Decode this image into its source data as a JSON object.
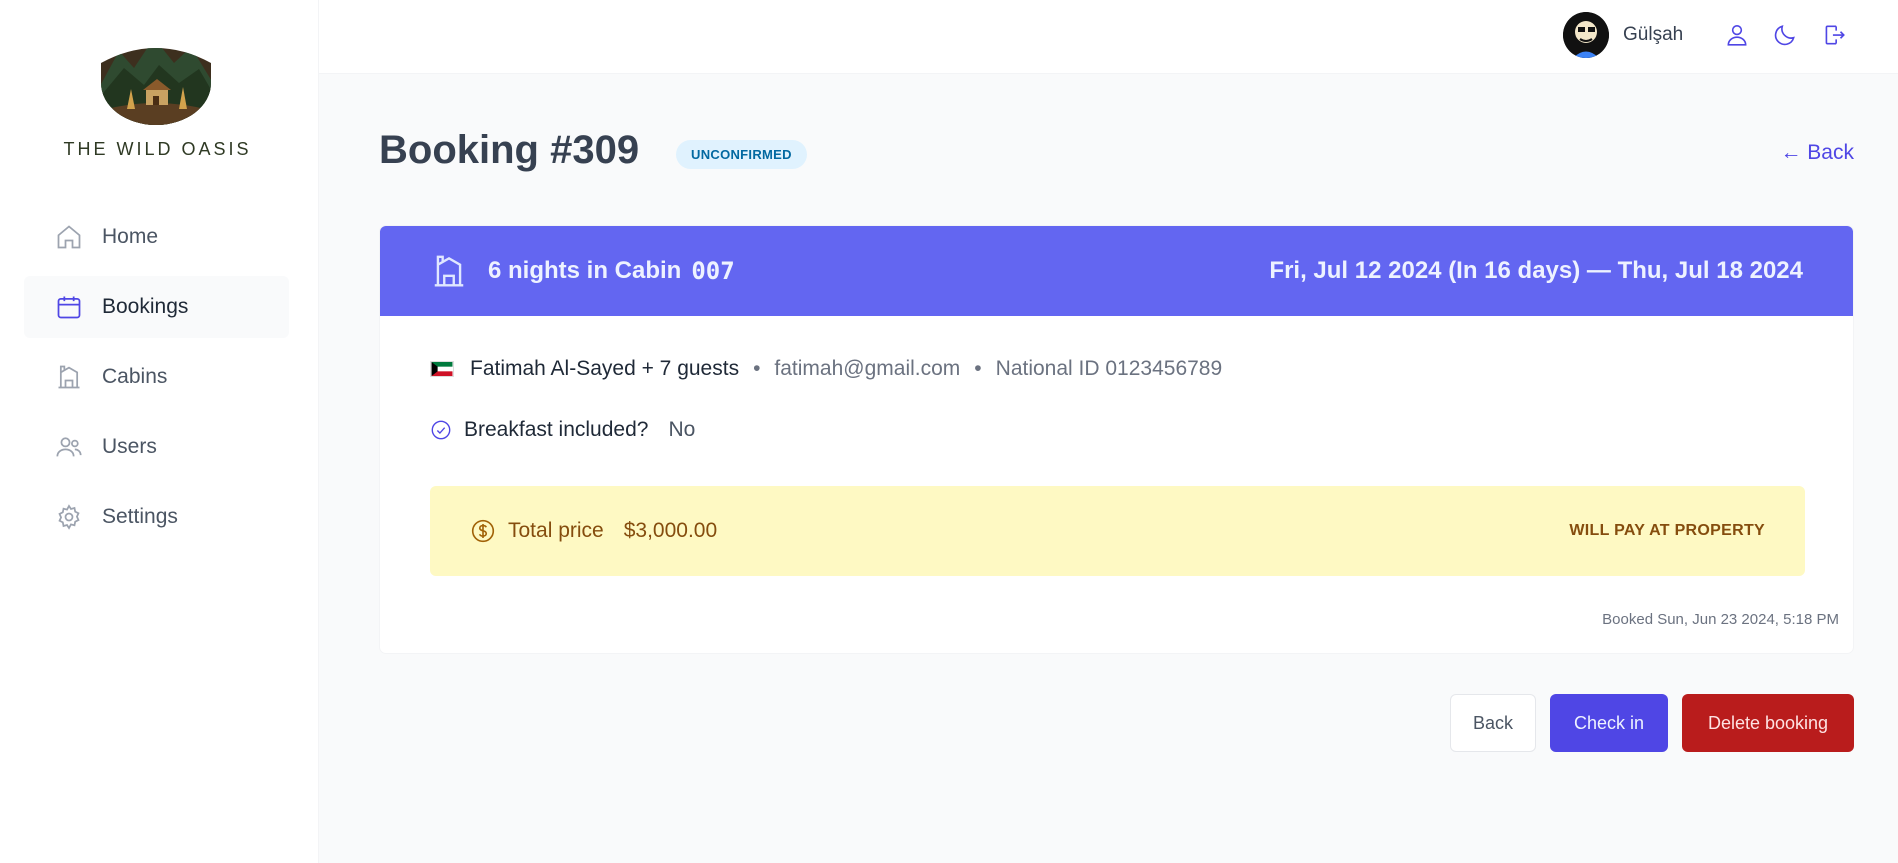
{
  "sidebar": {
    "brand": "THE WILD OASIS",
    "items": [
      {
        "label": "Home",
        "icon": "home-icon",
        "active": false
      },
      {
        "label": "Bookings",
        "icon": "calendar-icon",
        "active": true
      },
      {
        "label": "Cabins",
        "icon": "cabin-icon",
        "active": false
      },
      {
        "label": "Users",
        "icon": "users-icon",
        "active": false
      },
      {
        "label": "Settings",
        "icon": "gear-icon",
        "active": false
      }
    ]
  },
  "header": {
    "username": "Gülşah",
    "icons": [
      "user-icon",
      "moon-icon",
      "logout-icon"
    ]
  },
  "page": {
    "title": "Booking #309",
    "status": "UNCONFIRMED",
    "back_link": "← Back"
  },
  "booking": {
    "nights_text": "6 nights in Cabin",
    "cabin_code": "007",
    "dates": "Fri, Jul 12 2024 (In 16 days) — Thu, Jul 18 2024",
    "guest_name": "Fatimah Al-Sayed + 7 guests",
    "separator": "•",
    "guest_email": "fatimah@gmail.com",
    "national_id": "National ID 0123456789",
    "breakfast_label": "Breakfast included?",
    "breakfast_value": "No",
    "price_label": "Total price",
    "price_value": "$3,000.00",
    "payment_status": "WILL PAY AT PROPERTY",
    "booked_at": "Booked Sun, Jun 23 2024, 5:18 PM"
  },
  "actions": {
    "back": "Back",
    "check_in": "Check in",
    "delete": "Delete booking"
  },
  "colors": {
    "accent": "#4f46e5",
    "header_band": "#6366f1",
    "danger": "#b91c1c",
    "price_bg": "#fef9c3",
    "price_text": "#854d0e"
  }
}
